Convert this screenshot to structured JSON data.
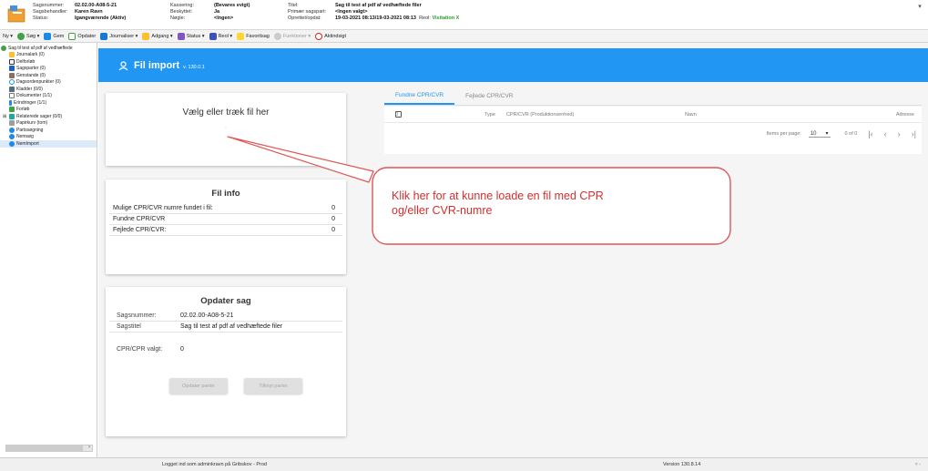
{
  "header": {
    "sagsnummer_label": "Sagsnummer:",
    "sagsnummer": "02.02.00-A08-5-21",
    "sagsbehandler_label": "Sagsbehandler:",
    "sagsbehandler": "Karen Ravn",
    "status_label": "Status:",
    "status": "Igangværende (Aktiv)",
    "kassering_label": "Kassering:",
    "kassering": "(Bevares evigt)",
    "beskyttet_label": "Beskyttet:",
    "beskyttet": "Ja",
    "noegle_label": "Nøgle:",
    "noegle": "<Ingen>",
    "titel_label": "Titel:",
    "titel": "Sag til test af pdf af vedhæftede filer",
    "primaer_label": "Primær sagspart:",
    "primaer": "<Ingen valgt>",
    "oprettet_label": "Oprettet/opdat:",
    "oprettet": "19-03-2021 08:13/19-03-2021 08:13",
    "rool_label": "Reol:",
    "rool": "Visitation X"
  },
  "toolbar": {
    "items": [
      "Ny",
      "Søg",
      "Gem",
      "Opdater",
      "Journaliser",
      "Adgang",
      "Status",
      "Reol",
      "Favoritsag",
      "Funktioner",
      "Aktindsigt"
    ]
  },
  "tree": {
    "items": [
      "Sag til test af pdf af vedhæftede",
      "Journalark (0)",
      "Delforløb",
      "Sagsparter (0)",
      "Genstande (0)",
      "Dagsordenpunkter (0)",
      "Kladder (0/0)",
      "Dokumenter (1/1)",
      "Erindringer (1/1)",
      "Forløb",
      "Relaterede sager (0/0)",
      "Papirkurv (tom)",
      "Partssøgning",
      "Nemsøg",
      "NemImport"
    ]
  },
  "banner": {
    "title": "Fil import",
    "version": "v. 130.0.1"
  },
  "drop": {
    "label": "Vælg eller træk fil her",
    "dot": "."
  },
  "info": {
    "title": "Fil info",
    "rows": [
      {
        "k": "Mulige CPR/CVR numre fundet i fil:",
        "v": "0"
      },
      {
        "k": "Fundne CPR/CVR",
        "v": "0"
      },
      {
        "k": "Fejlede CPR/CVR:",
        "v": "0"
      }
    ]
  },
  "upd": {
    "title": "Opdater sag",
    "sagsnummer_k": "Sagsnummer:",
    "sagsnummer_v": "02.02.00-A08-5-21",
    "sagstitel_k": "Sagstitel",
    "sagstitel_v": "Sag til test af pdf af vedhæftede filer",
    "cpr_k": "CPR/CPR valgt:",
    "cpr_v": "0",
    "btn1": "Opdater parter",
    "btn2": "Tilknyt parter"
  },
  "tabs": [
    "Fundne CPR/CVR",
    "Fejlede CPR/CVR"
  ],
  "grid": {
    "zero": "0",
    "cols": [
      "Type",
      "CPR/CVR (Produktionsenhed)",
      "Navn",
      "Adresse"
    ],
    "ipp_label": "Items per page:",
    "ipp": "10",
    "range": "0 of 0"
  },
  "callout": {
    "line1": "Klik her for at kunne loade en fil med CPR",
    "line2": "og/eller CVR-numre"
  },
  "status": {
    "left": "Logget ind som adminkravn på Gribskov - Prod",
    "right": "Version 130.8.14",
    "end": "▿ -"
  },
  "colors": {
    "accent": "#2196f3",
    "callout_border": "#e05555",
    "callout_text": "#d32f2f"
  }
}
